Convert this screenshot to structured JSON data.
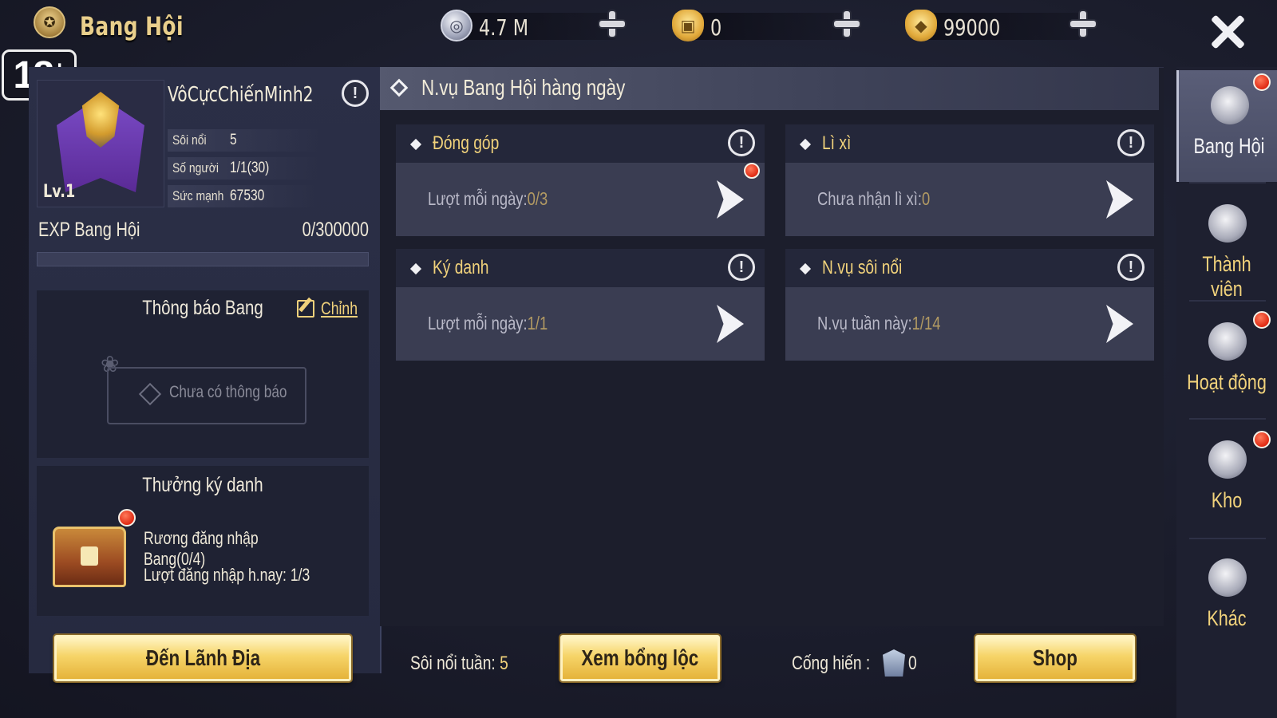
{
  "header": {
    "title": "Bang Hội",
    "age_badge": "18",
    "age_badge_plus": "+",
    "currencies": [
      {
        "icon": "silver-coin-icon",
        "value": "4.7 M"
      },
      {
        "icon": "locked-gold-ingot-icon",
        "value": "0"
      },
      {
        "icon": "gold-ingot-icon",
        "value": "99000"
      }
    ]
  },
  "guild": {
    "name": "VôCựcChiếnMinh2",
    "level": "Lv.1",
    "stats": [
      {
        "label": "Sôi nổi",
        "value": "5"
      },
      {
        "label": "Số người",
        "value": "1/1(30)"
      },
      {
        "label": "Sức mạnh",
        "value": "67530"
      }
    ],
    "exp_label": "EXP Bang Hội",
    "exp_value": "0/300000",
    "exp_progress": 0
  },
  "notice": {
    "title": "Thông báo Bang",
    "edit_label": "Chỉnh",
    "empty_text": "Chưa có thông báo"
  },
  "reward": {
    "title": "Thưởng ký danh",
    "line1": "Rương đăng nhập Bang(0/4)",
    "line2_label": "Lượt đăng nhập h.nay:",
    "line2_value": "1/3"
  },
  "buttons": {
    "territory": "Đến Lãnh Địa",
    "salary": "Xem bổng lộc",
    "shop": "Shop"
  },
  "main": {
    "title": "N.vụ Bang Hội hàng ngày",
    "cards": [
      {
        "title": "Đóng góp",
        "label": "Lượt mỗi ngày:",
        "value": "0/3",
        "has_dot": true
      },
      {
        "title": "Lì xì",
        "label": "Chưa nhận lì xì:",
        "value": "0",
        "has_dot": false
      },
      {
        "title": "Ký danh",
        "label": "Lượt mỗi ngày:",
        "value": "1/1",
        "has_dot": false
      },
      {
        "title": "N.vụ sôi nổi",
        "label": "N.vụ tuần này:",
        "value": "1/14",
        "has_dot": false
      }
    ]
  },
  "bottom": {
    "weekly_label": "Sôi nổi tuần:",
    "weekly_value": "5",
    "contrib_label": "Cống hiến :",
    "contrib_value": "0"
  },
  "sidebar": {
    "items": [
      {
        "label": "Bang Hội",
        "icon": "guild-emblem-icon",
        "active": true,
        "dot": true
      },
      {
        "label": "Thành viên",
        "icon": "member-helmet-icon",
        "active": false,
        "dot": false
      },
      {
        "label": "Hoạt động",
        "icon": "activity-bowl-icon",
        "active": false,
        "dot": true
      },
      {
        "label": "Kho",
        "icon": "warehouse-icon",
        "active": false,
        "dot": true
      },
      {
        "label": "Khác",
        "icon": "scroll-icon",
        "active": false,
        "dot": false
      }
    ]
  },
  "colors": {
    "accent_gold": "#f1d27b",
    "panel": "#2b2f47",
    "alert_red": "#e02b14"
  }
}
